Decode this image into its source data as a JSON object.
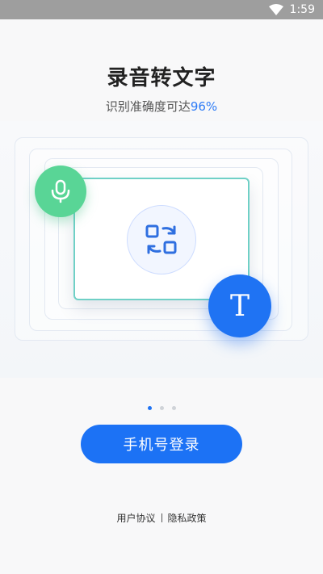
{
  "status_bar": {
    "time": "1:59"
  },
  "header": {
    "title": "录音转文字",
    "subtitle": "识别准确度可达",
    "accuracy": "96%"
  },
  "illustration": {
    "text_glyph": "T"
  },
  "pager": {
    "count": 3,
    "active_index": 0
  },
  "login_button": {
    "label": "手机号登录"
  },
  "footer": {
    "user_agreement": "用户协议",
    "privacy_policy": "隐私政策"
  },
  "colors": {
    "primary": "#1c72f5",
    "mic_green": "#59d596",
    "accent_text": "#2f7cf6"
  }
}
